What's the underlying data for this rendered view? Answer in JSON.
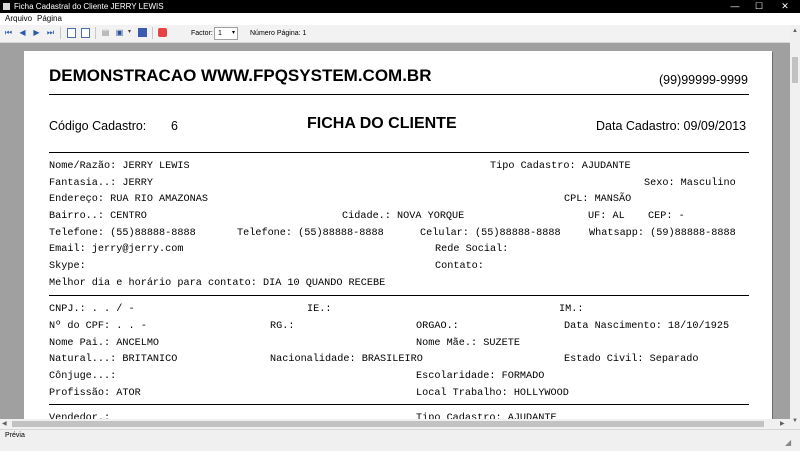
{
  "window": {
    "title": "Ficha Cadastral do Cliente JERRY LEWIS",
    "minimize": "—",
    "maximize": "☐",
    "close": "✕"
  },
  "menu": {
    "file": "Arquivo",
    "page": "Página"
  },
  "toolbar": {
    "factor_label": "Factor:",
    "factor_value": "1",
    "page_number_label": "Número Página: 1",
    "icons": [
      "first-page-icon",
      "previous-page-icon",
      "next-page-icon",
      "last-page-icon",
      "single-page-icon",
      "two-pages-icon",
      "print-icon",
      "save-icon",
      "report-icon",
      "close-preview-icon"
    ]
  },
  "report": {
    "company": "DEMONSTRACAO WWW.FPQSYSTEM.COM.BR",
    "phone": "(99)99999-9999",
    "code_label": "Código Cadastro:",
    "code_value": "6",
    "form_title": "FICHA DO CLIENTE",
    "reg_date": "Data Cadastro: 09/09/2013",
    "l1a": "Nome/Razão: JERRY LEWIS",
    "l1b": "Tipo Cadastro: AJUDANTE",
    "l2a": "Fantasia..: JERRY",
    "l2b": "Sexo: Masculino",
    "l3a": "Endereço: RUA RIO AMAZONAS",
    "l3b": "CPL: MANSÃO",
    "l4a": "Bairro..: CENTRO",
    "l4b": "Cidade.: NOVA YORQUE",
    "l4c": "UF: AL",
    "l4d": "CEP:     -",
    "l5a": "Telefone: (55)88888-8888",
    "l5b": "Telefone: (55)88888-8888",
    "l5c": "Celular: (55)88888-8888",
    "l5d": "Whatsapp: (59)88888-8888",
    "l6a": "Email: jerry@jerry.com",
    "l6b": "Rede Social:",
    "l7a": "Skype:",
    "l7b": "Contato:",
    "l8a": "Melhor dia e horário para contato: DIA 10 QUANDO RECEBE",
    "l9a": "CNPJ.:   .   .   /    -",
    "l9b": "IE.:",
    "l9c": "IM.:",
    "l10a": "Nº do CPF:    .   .   -",
    "l10b": "RG.:",
    "l10c": "ORGAO.:",
    "l10d": "Data Nascimento: 18/10/1925",
    "l11a": "Nome Pai.: ANCELMO",
    "l11b": "Nome Mãe.: SUZETE",
    "l12a": "Natural...: BRITANICO",
    "l12b": "Nacionalidade: BRASILEIRO",
    "l12c": "Estado Civil: Separado",
    "l13a": "Cônjuge...:",
    "l13b": "Escolaridade: FORMADO",
    "l14a": "Profissão: ATOR",
    "l14b": "Local Trabalho: HOLLYWOOD",
    "l15a": "Vendedor.:",
    "l15b": "Tipo Cadastro: AJUDANTE"
  },
  "status": {
    "text": "Prévia"
  }
}
